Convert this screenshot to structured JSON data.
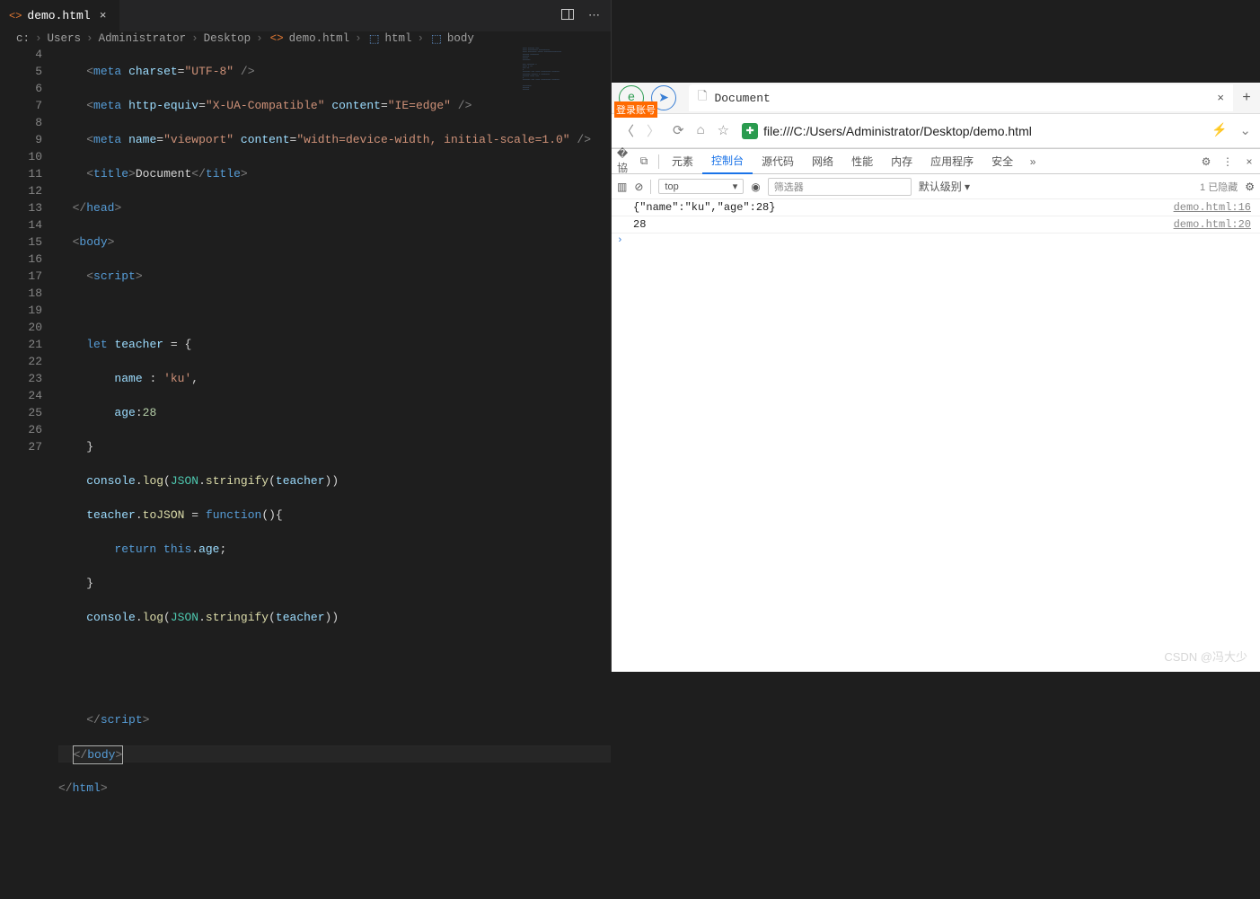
{
  "editor": {
    "tab": {
      "title": "demo.html"
    },
    "breadcrumbs": [
      "c:",
      "Users",
      "Administrator",
      "Desktop",
      "demo.html",
      "html",
      "body"
    ],
    "lineStart": 4,
    "lineEnd": 27,
    "currentLine": 24
  },
  "browser": {
    "loginBadge": "登录账号",
    "tabTitle": "Document",
    "url": "file:///C:/Users/Administrator/Desktop/demo.html"
  },
  "devtools": {
    "tabs": [
      "元素",
      "控制台",
      "源代码",
      "网络",
      "性能",
      "内存",
      "应用程序",
      "安全"
    ],
    "activeTab": "控制台",
    "scope": "top",
    "filterPlaceholder": "筛选器",
    "level": "默认级别 ▾",
    "hiddenCount": "1 已隐藏",
    "rows": [
      {
        "text": "{\"name\":\"ku\",\"age\":28}",
        "src": "demo.html:16"
      },
      {
        "text": "28",
        "src": "demo.html:20"
      }
    ]
  },
  "watermark": "CSDN @冯大少"
}
